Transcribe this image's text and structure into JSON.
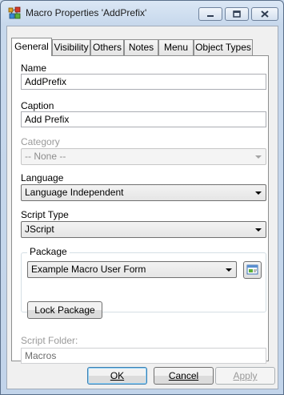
{
  "window": {
    "title": "Macro Properties 'AddPrefix'",
    "icon": "macro-app-icon",
    "controls": {
      "minimize_icon": "minimize-icon",
      "maximize_icon": "maximize-icon",
      "close_icon": "close-icon"
    }
  },
  "tabs": [
    {
      "label": "General",
      "active": true
    },
    {
      "label": "Visibility",
      "active": false
    },
    {
      "label": "Others",
      "active": false
    },
    {
      "label": "Notes",
      "active": false
    },
    {
      "label": "Menu",
      "active": false
    },
    {
      "label": "Object Types",
      "active": false
    }
  ],
  "form": {
    "name_label": "Name",
    "name_value": "AddPrefix",
    "caption_label": "Caption",
    "caption_value": "Add Prefix",
    "category_label": "Category",
    "category_value": "-- None --",
    "language_label": "Language",
    "language_value": "Language Independent",
    "script_type_label": "Script Type",
    "script_type_value": "JScript",
    "package_label": "Package",
    "package_value": "Example Macro User Form",
    "package_browse_icon": "package-browse-icon",
    "lock_package_label": "Lock Package",
    "script_folder_label": "Script Folder:",
    "script_folder_value": "Macros"
  },
  "footer": {
    "ok_label": "OK",
    "cancel_label": "Cancel",
    "apply_label": "Apply"
  },
  "colors": {
    "window_frame": "#c7d8ec",
    "dialog_bg": "#f0f0f0",
    "disabled_text": "#9a9a9a",
    "default_button_border": "#3c7fb1"
  }
}
